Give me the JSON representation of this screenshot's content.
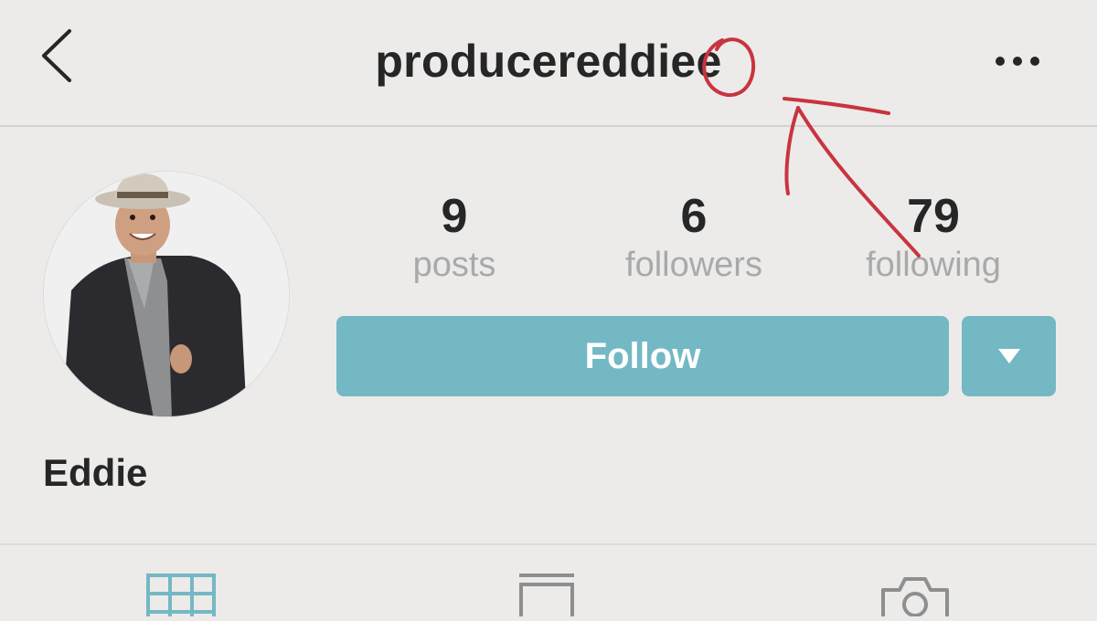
{
  "header": {
    "username": "produceredd​iee",
    "back_icon": "chevron-left-icon",
    "more_icon": "more-horizontal-icon"
  },
  "profile": {
    "display_name": "Eddie",
    "stats": [
      {
        "value": "9",
        "label": "posts"
      },
      {
        "value": "6",
        "label": "followers"
      },
      {
        "value": "79",
        "label": "following"
      }
    ]
  },
  "actions": {
    "follow_label": "Follow",
    "dropdown_icon": "caret-down-icon"
  },
  "tabs": [
    {
      "icon": "grid-icon",
      "active": true
    },
    {
      "icon": "list-icon",
      "active": false
    },
    {
      "icon": "tagged-camera-icon",
      "active": false
    }
  ],
  "colors": {
    "accent": "#74b8c4",
    "background": "#ecebea",
    "annotation_red": "#c8343f"
  }
}
